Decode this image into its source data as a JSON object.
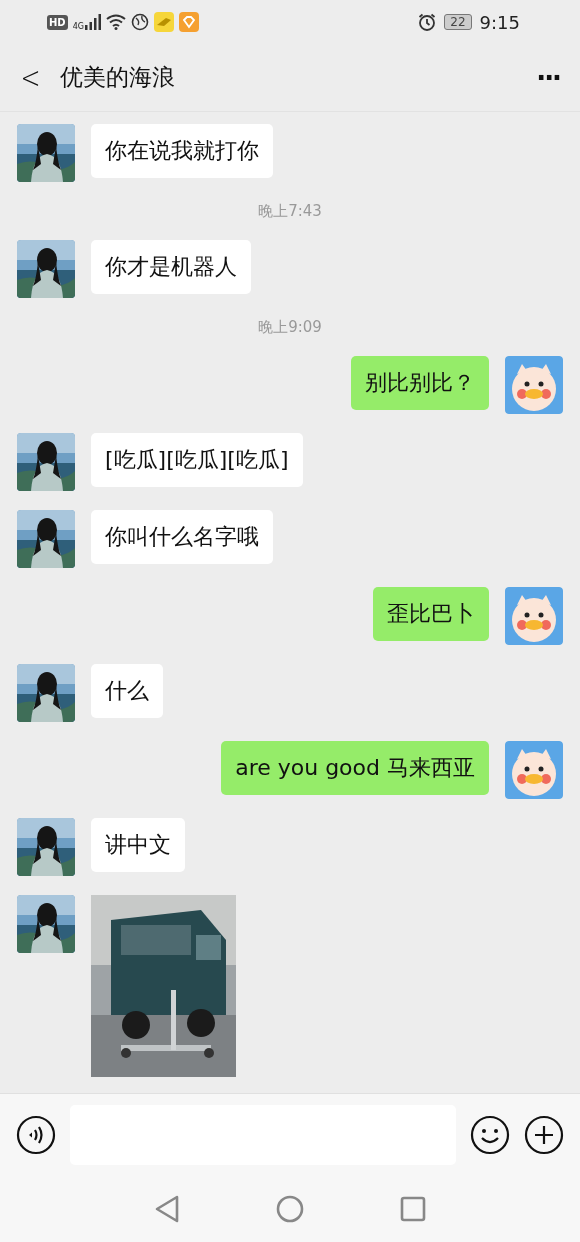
{
  "status_bar": {
    "network_badge": "HD",
    "network_type": "4G",
    "battery": "22",
    "time": "9:15"
  },
  "header": {
    "back": "<",
    "title": "优美的海浪",
    "more": "···"
  },
  "messages": [
    {
      "kind": "in",
      "text": "你在说我就打你"
    },
    {
      "kind": "time",
      "text": "晚上7:43"
    },
    {
      "kind": "in",
      "text": "你才是机器人"
    },
    {
      "kind": "time",
      "text": "晚上9:09"
    },
    {
      "kind": "out",
      "text": "别比别比？"
    },
    {
      "kind": "in",
      "text": "[吃瓜][吃瓜][吃瓜]"
    },
    {
      "kind": "in",
      "text": "你叫什么名字哦"
    },
    {
      "kind": "out",
      "text": "歪比巴卜"
    },
    {
      "kind": "in",
      "text": "什么"
    },
    {
      "kind": "out",
      "text": "are you good 马来西亚"
    },
    {
      "kind": "in",
      "text": "讲中文"
    },
    {
      "kind": "in_image"
    }
  ]
}
